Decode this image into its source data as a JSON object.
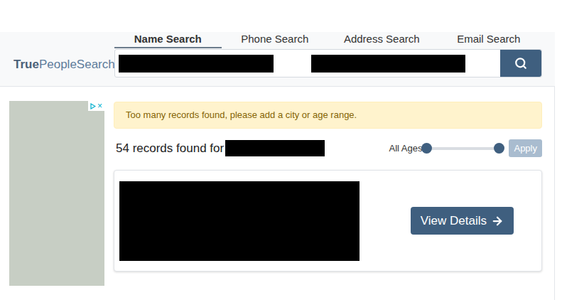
{
  "logo": {
    "bold": "True",
    "rest": "PeopleSearch"
  },
  "tabs": [
    {
      "label": "Name Search",
      "selected": true
    },
    {
      "label": "Phone Search",
      "selected": false
    },
    {
      "label": "Address Search",
      "selected": false
    },
    {
      "label": "Email Search",
      "selected": false
    }
  ],
  "ad": {
    "close": "×"
  },
  "alert": "Too many records found, please add a city or age range.",
  "results": {
    "count_text": "54 records found for",
    "age_filter": {
      "label": "All Ages",
      "low": 0,
      "high": 1
    },
    "apply": {
      "label": "Apply",
      "disabled": true
    }
  },
  "records": [
    {
      "button": "View Details"
    }
  ]
}
